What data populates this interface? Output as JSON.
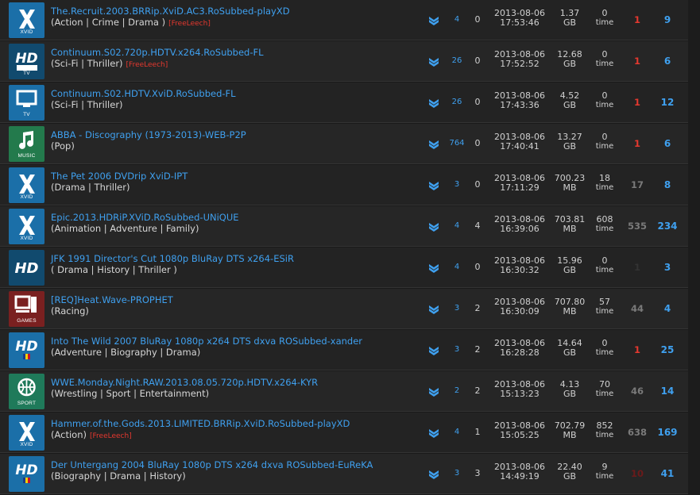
{
  "colors": {
    "link": "#3fa0ef",
    "freeleech": "#e4382f",
    "seed_red": "#e4382f",
    "seed_gray": "#7a7a7a",
    "seed_dark": "#333333",
    "seed_darkred": "#6b1a1a",
    "cat_blue": "#1b6fa8",
    "cat_dark": "#114a6e",
    "cat_music": "#237a4c",
    "cat_games": "#7a2020",
    "cat_sport": "#1f7a5a"
  },
  "torrents": [
    {
      "category": "XVID",
      "cat_icon": "xvid-icon",
      "name": "The.Recruit.2003.BRRip.XviD.AC3.RoSubbed-playXD",
      "genre": "(Action | Crime | Drama )",
      "freeleech": "[FreeLeech]",
      "comments": "4",
      "files": "0",
      "date": "2013-08-06",
      "time": "17:53:46",
      "size": "1.37",
      "size_unit": "GB",
      "snatched": "0",
      "snatched_unit": "time",
      "seeders": "1",
      "seed_color": "#e4382f",
      "leechers": "9"
    },
    {
      "category": "TV",
      "cat_icon": "hd-tv-icon",
      "name": "Continuum.S02.720p.HDTV.x264.RoSubbed-FL",
      "genre": "(Sci-Fi | Thriller)",
      "freeleech": "[FreeLeech]",
      "comments": "26",
      "files": "0",
      "date": "2013-08-06",
      "time": "17:52:52",
      "size": "12.68",
      "size_unit": "GB",
      "snatched": "0",
      "snatched_unit": "time",
      "seeders": "1",
      "seed_color": "#e4382f",
      "leechers": "6"
    },
    {
      "category": "TV",
      "cat_icon": "tv-monitor-icon",
      "name": "Continuum.S02.HDTV.XviD.RoSubbed-FL",
      "genre": "(Sci-Fi | Thriller)",
      "freeleech": "",
      "comments": "26",
      "files": "0",
      "date": "2013-08-06",
      "time": "17:43:36",
      "size": "4.52",
      "size_unit": "GB",
      "snatched": "0",
      "snatched_unit": "time",
      "seeders": "1",
      "seed_color": "#e4382f",
      "leechers": "12"
    },
    {
      "category": "MUSIC",
      "cat_icon": "music-note-icon",
      "name": "ABBA - Discography (1973-2013)-WEB-P2P",
      "genre": "(Pop)",
      "freeleech": "",
      "comments": "764",
      "files": "0",
      "date": "2013-08-06",
      "time": "17:40:41",
      "size": "13.27",
      "size_unit": "GB",
      "snatched": "0",
      "snatched_unit": "time",
      "seeders": "1",
      "seed_color": "#e4382f",
      "leechers": "6"
    },
    {
      "category": "XVID",
      "cat_icon": "xvid-icon",
      "name": "The Pet 2006 DVDrip XviD-IPT",
      "genre": "(Drama | Thriller)",
      "freeleech": "",
      "comments": "3",
      "files": "0",
      "date": "2013-08-06",
      "time": "17:11:29",
      "size": "700.23",
      "size_unit": "MB",
      "snatched": "18",
      "snatched_unit": "time",
      "seeders": "17",
      "seed_color": "#7a7a7a",
      "leechers": "8"
    },
    {
      "category": "XVID",
      "cat_icon": "xvid-icon",
      "name": "Epic.2013.HDRiP.XViD.RoSubbed-UNiQUE",
      "genre": "(Animation | Adventure | Family)",
      "freeleech": "",
      "comments": "4",
      "files": "4",
      "date": "2013-08-06",
      "time": "16:39:06",
      "size": "703.81",
      "size_unit": "MB",
      "snatched": "608",
      "snatched_unit": "time",
      "seeders": "535",
      "seed_color": "#7a7a7a",
      "leechers": "234"
    },
    {
      "category": "HD",
      "cat_icon": "hd-icon",
      "name": "JFK 1991 Director's Cut 1080p BluRay DTS x264-ESiR",
      "genre": "( Drama | History | Thriller )",
      "freeleech": "",
      "comments": "4",
      "files": "0",
      "date": "2013-08-06",
      "time": "16:30:32",
      "size": "15.96",
      "size_unit": "GB",
      "snatched": "0",
      "snatched_unit": "time",
      "seeders": "1",
      "seed_color": "#333333",
      "leechers": "3"
    },
    {
      "category": "GAMES",
      "cat_icon": "games-pc-icon",
      "name": "[REQ]Heat.Wave-PROPHET",
      "genre": "(Racing)",
      "freeleech": "",
      "comments": "3",
      "files": "2",
      "date": "2013-08-06",
      "time": "16:30:09",
      "size": "707.80",
      "size_unit": "MB",
      "snatched": "57",
      "snatched_unit": "time",
      "seeders": "44",
      "seed_color": "#7a7a7a",
      "leechers": "4"
    },
    {
      "category": "HD",
      "cat_icon": "hd-ro-icon",
      "name": "Into The Wild 2007 BluRay 1080p x264 DTS dxva ROSubbed-xander",
      "genre": "(Adventure | Biography | Drama)",
      "freeleech": "",
      "comments": "3",
      "files": "2",
      "date": "2013-08-06",
      "time": "16:28:28",
      "size": "14.64",
      "size_unit": "GB",
      "snatched": "0",
      "snatched_unit": "time",
      "seeders": "1",
      "seed_color": "#e4382f",
      "leechers": "25"
    },
    {
      "category": "SPORT",
      "cat_icon": "basketball-icon",
      "name": "WWE.Monday.Night.RAW.2013.08.05.720p.HDTV.x264-KYR",
      "genre": "(Wrestling | Sport | Entertainment)",
      "freeleech": "",
      "comments": "2",
      "files": "2",
      "date": "2013-08-06",
      "time": "15:13:23",
      "size": "4.13",
      "size_unit": "GB",
      "snatched": "70",
      "snatched_unit": "time",
      "seeders": "46",
      "seed_color": "#7a7a7a",
      "leechers": "14"
    },
    {
      "category": "XVID",
      "cat_icon": "xvid-icon",
      "name": "Hammer.of.the.Gods.2013.LIMITED.BRRip.XviD.RoSubbed-playXD",
      "genre": "(Action)",
      "freeleech": "[FreeLeech]",
      "comments": "4",
      "files": "1",
      "date": "2013-08-06",
      "time": "15:05:25",
      "size": "702.79",
      "size_unit": "MB",
      "snatched": "852",
      "snatched_unit": "time",
      "seeders": "638",
      "seed_color": "#7a7a7a",
      "leechers": "169"
    },
    {
      "category": "HD",
      "cat_icon": "hd-ro-icon",
      "name": "Der Untergang 2004 BluRay 1080p DTS x264 dxva ROSubbed-EuReKA",
      "genre": "(Biography | Drama | History)",
      "freeleech": "",
      "comments": "3",
      "files": "3",
      "date": "2013-08-06",
      "time": "14:49:19",
      "size": "22.40",
      "size_unit": "GB",
      "snatched": "9",
      "snatched_unit": "time",
      "seeders": "10",
      "seed_color": "#6b1a1a",
      "leechers": "41"
    }
  ]
}
